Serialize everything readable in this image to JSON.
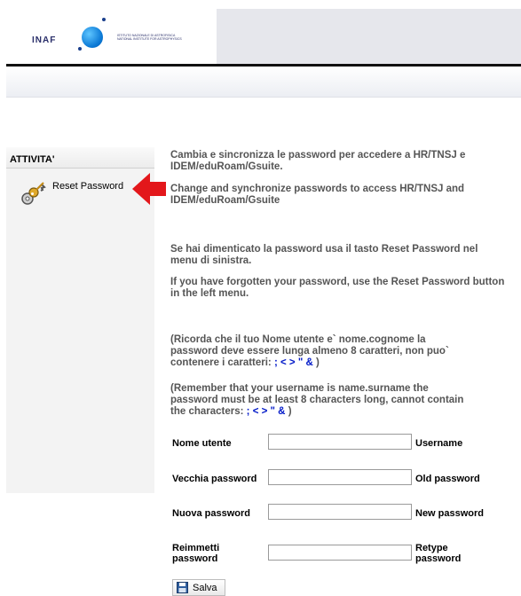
{
  "header": {
    "logo_text": "INAF",
    "logo_subtitle_line1": "ISTITUTO NAZIONALE DI ASTROFISICA",
    "logo_subtitle_line2": "NATIONAL INSTITUTE FOR ASTROPHYSICS"
  },
  "sidebar": {
    "title": "ATTIVITA'",
    "items": [
      {
        "label": "Reset Password",
        "icon": "keys-icon"
      }
    ]
  },
  "content": {
    "p1_it": "Cambia e sincronizza le password per accedere a HR/TNSJ e IDEM/eduRoam/Gsuite.",
    "p1_en": "Change and synchronize passwords to access HR/TNSJ and IDEM/eduRoam/Gsuite",
    "p2_it": "Se hai dimenticato la password usa il tasto Reset Password nel menu di sinistra.",
    "p2_en": "If you have forgotten your password, use the Reset Password button in the left menu.",
    "p3_it": "(Ricorda che il tuo Nome utente e` nome.cognome la password deve essere lunga almeno 8 caratteri, non puo` contenere i caratteri:",
    "p3_it_chars": "; < > \" &",
    "p3_it_close": ")",
    "p3_en": "(Remember that your username is name.surname the password must be at least 8 characters long, cannot contain the characters:",
    "p3_en_chars": "; < > \" &",
    "p3_en_close": ")"
  },
  "form": {
    "fields": [
      {
        "label_it": "Nome utente",
        "label_en": "Username",
        "value": ""
      },
      {
        "label_it": "Vecchia password",
        "label_en": "Old password",
        "value": ""
      },
      {
        "label_it": "Nuova password",
        "label_en": "New password",
        "value": ""
      },
      {
        "label_it": "Reimmetti password",
        "label_en": "Retype password",
        "value": ""
      }
    ],
    "save_label": "Salva"
  },
  "colors": {
    "accent_blue": "#0018c8",
    "arrow_red": "#e3171b",
    "sidebar_bg": "#f3f3f3"
  }
}
